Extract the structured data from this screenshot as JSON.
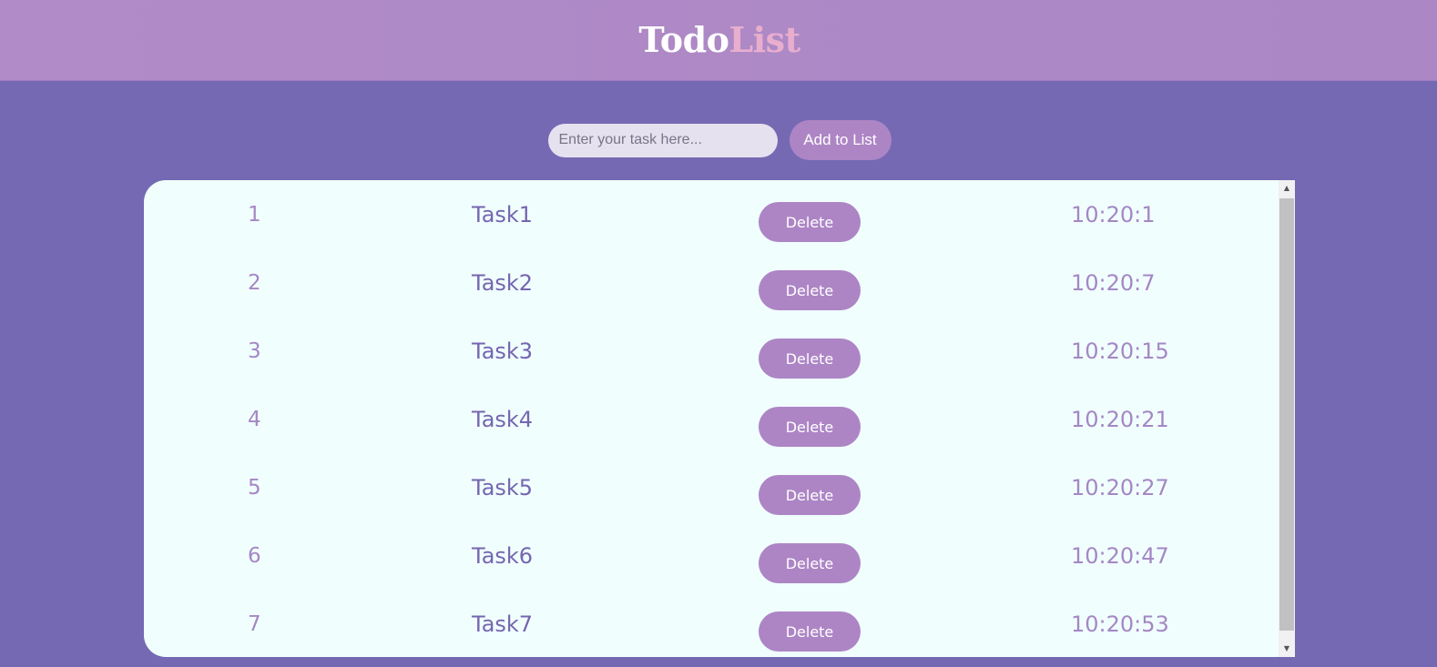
{
  "header": {
    "title_part1": "Todo",
    "title_part2": "List"
  },
  "form": {
    "input_placeholder": "Enter your task here...",
    "input_value": "",
    "add_button_label": "Add to List"
  },
  "tasks": [
    {
      "number": "1",
      "name": "Task1",
      "delete_label": "Delete",
      "time": "10:20:1"
    },
    {
      "number": "2",
      "name": "Task2",
      "delete_label": "Delete",
      "time": "10:20:7"
    },
    {
      "number": "3",
      "name": "Task3",
      "delete_label": "Delete",
      "time": "10:20:15"
    },
    {
      "number": "4",
      "name": "Task4",
      "delete_label": "Delete",
      "time": "10:20:21"
    },
    {
      "number": "5",
      "name": "Task5",
      "delete_label": "Delete",
      "time": "10:20:27"
    },
    {
      "number": "6",
      "name": "Task6",
      "delete_label": "Delete",
      "time": "10:20:47"
    },
    {
      "number": "7",
      "name": "Task7",
      "delete_label": "Delete",
      "time": "10:20:53"
    }
  ],
  "icons": {
    "scroll_up": "scroll-up-arrow-icon",
    "scroll_down": "scroll-down-arrow-icon"
  },
  "colors": {
    "page_background": "#7569b3",
    "header_background": "#ac87c6",
    "title_primary": "#ffffff",
    "title_accent": "#e9aece",
    "button": "#ad85c5",
    "panel_background": "#f0fffe",
    "task_text": "#7566b0",
    "number_time_text": "#a587c4"
  }
}
